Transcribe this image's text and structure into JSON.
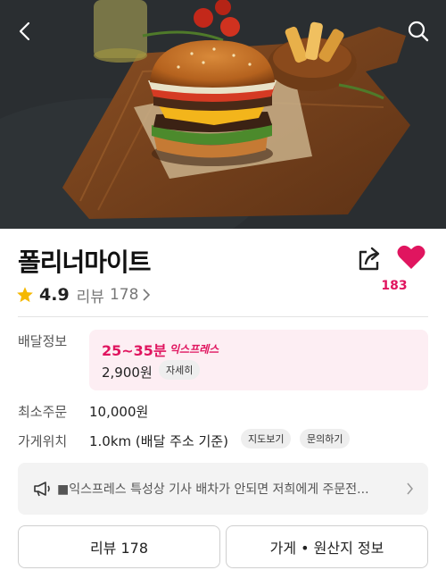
{
  "store": {
    "name": "폴리너마이트",
    "rating": "4.9",
    "review_label": "리뷰",
    "review_count": "178",
    "like_count": "183"
  },
  "delivery": {
    "label": "배달정보",
    "time": "25~35분",
    "express_tag": "익스프레스",
    "fee": "2,900원",
    "detail_label": "자세히"
  },
  "min_order": {
    "label": "최소주문",
    "value": "10,000원"
  },
  "location": {
    "label": "가게위치",
    "value": "1.0km (배달 주소 기준)",
    "map_label": "지도보기",
    "inquiry_label": "문의하기"
  },
  "notice": {
    "text": "■익스프레스 특성상 기사 배차가 안되면 저희에게 주문전..."
  },
  "tabs": {
    "reviews": "리뷰 178",
    "store_info": "가게 • 원산지 정보"
  },
  "colors": {
    "accent": "#e0155f",
    "star": "#f5b800",
    "delivery_bg": "#fdeef3"
  },
  "icons": [
    "back-arrow-icon",
    "search-icon",
    "share-icon",
    "heart-icon",
    "star-icon",
    "chevron-right-icon",
    "megaphone-icon"
  ]
}
